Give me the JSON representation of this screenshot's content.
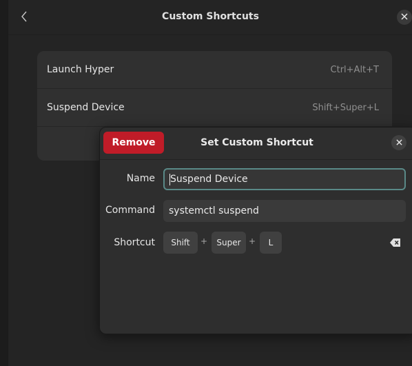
{
  "header": {
    "title": "Custom Shortcuts",
    "back_icon": "chevron-left-icon",
    "close_icon": "close-icon"
  },
  "shortcuts": [
    {
      "name": "Launch Hyper",
      "accel": "Ctrl+Alt+T"
    },
    {
      "name": "Suspend Device",
      "accel": "Shift+Super+L"
    }
  ],
  "dialog": {
    "title": "Set Custom Shortcut",
    "remove_label": "Remove",
    "name_label": "Name",
    "name_value": "Suspend Device",
    "command_label": "Command",
    "command_value": "systemctl suspend",
    "shortcut_label": "Shortcut",
    "keys": [
      "Shift",
      "Super",
      "L"
    ],
    "plus": "+",
    "clear_icon": "backspace-clear-icon"
  },
  "colors": {
    "destructive": "#c01c28",
    "focus_ring": "#5a8a88",
    "window_bg": "#242424"
  }
}
